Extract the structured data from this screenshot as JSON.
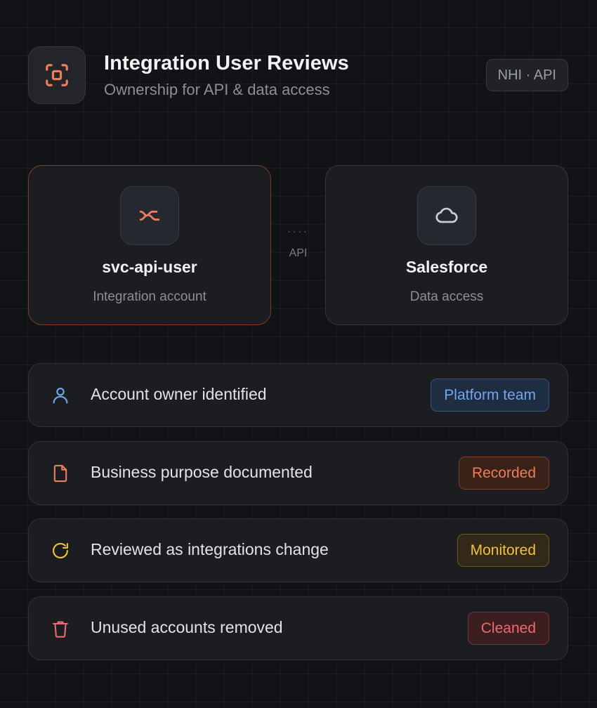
{
  "header": {
    "title": "Integration User Reviews",
    "subtitle": "Ownership for API & data access",
    "tag": "NHI · API",
    "icon": "scan-focus-icon"
  },
  "flow": {
    "source": {
      "name": "svc-api-user",
      "description": "Integration account",
      "icon": "api-connector-icon"
    },
    "connector_label": "API",
    "target": {
      "name": "Salesforce",
      "description": "Data access",
      "icon": "cloud-icon"
    }
  },
  "checklist": [
    {
      "label": "Account owner identified",
      "status": "Platform team",
      "icon": "user-icon",
      "color": "#6fa8ee"
    },
    {
      "label": "Business purpose documented",
      "status": "Recorded",
      "icon": "document-icon",
      "color": "#ef7d57"
    },
    {
      "label": "Reviewed as integrations change",
      "status": "Monitored",
      "icon": "refresh-icon",
      "color": "#f0c23b"
    },
    {
      "label": "Unused accounts removed",
      "status": "Cleaned",
      "icon": "trash-icon",
      "color": "#ee6a6e"
    }
  ],
  "colors": {
    "accent": "#ef7d57",
    "background": "#121316",
    "card": "#1c1d21"
  }
}
